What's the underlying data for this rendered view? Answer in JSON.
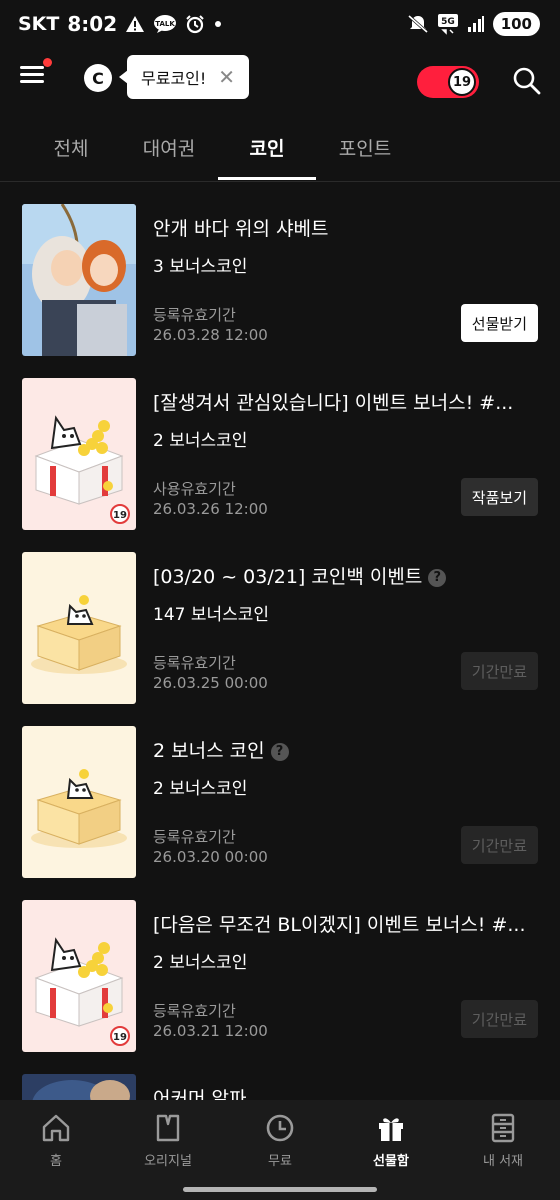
{
  "status_bar": {
    "carrier": "SKT",
    "time": "8:02",
    "talk_badge": "TALK",
    "network": "5G",
    "battery": "100"
  },
  "header": {
    "logo_letter": "C",
    "tooltip_label": "무료코인!",
    "adult_badge": "19"
  },
  "tabs": [
    {
      "label": "전체"
    },
    {
      "label": "대여권"
    },
    {
      "label": "코인"
    },
    {
      "label": "포인트"
    }
  ],
  "items": [
    {
      "title": "안개 바다 위의 샤베트",
      "bonus": "3 보너스코인",
      "expiry_label": "등록유효기간",
      "expiry_date": "26.03.28 12:00",
      "action": "선물받기",
      "help": ""
    },
    {
      "title": "[잘생겨서 관심있습니다] 이벤트 보너스! #...",
      "bonus": "2 보너스코인",
      "expiry_label": "사용유효기간",
      "expiry_date": "26.03.26 12:00",
      "action": "작품보기",
      "help": "",
      "adult_badge": "19"
    },
    {
      "title": "[03/20 ~ 03/21] 코인백 이벤트",
      "bonus": "147 보너스코인",
      "expiry_label": "등록유효기간",
      "expiry_date": "26.03.25 00:00",
      "action": "기간만료",
      "help": "?"
    },
    {
      "title": "2 보너스 코인",
      "bonus": "2 보너스코인",
      "expiry_label": "등록유효기간",
      "expiry_date": "26.03.20 00:00",
      "action": "기간만료",
      "help": "?"
    },
    {
      "title": "[다음은 무조건 BL이겠지] 이벤트 보너스! #...",
      "bonus": "2 보너스코인",
      "expiry_label": "등록유효기간",
      "expiry_date": "26.03.21 12:00",
      "action": "기간만료",
      "help": "",
      "adult_badge": "19"
    },
    {
      "title": "어커머 알파",
      "bonus": "",
      "expiry_label": "",
      "expiry_date": "",
      "action": "",
      "help": ""
    }
  ],
  "bottom_nav": [
    {
      "label": "홈",
      "icon": "home-icon"
    },
    {
      "label": "오리지널",
      "icon": "original-icon"
    },
    {
      "label": "무료",
      "icon": "clock-icon"
    },
    {
      "label": "선물함",
      "icon": "gift-icon"
    },
    {
      "label": "내 서재",
      "icon": "bookshelf-icon"
    }
  ],
  "colors": {
    "background": "#121212",
    "accent_red": "#ff1f3d",
    "muted_text": "#9a9a9a"
  }
}
